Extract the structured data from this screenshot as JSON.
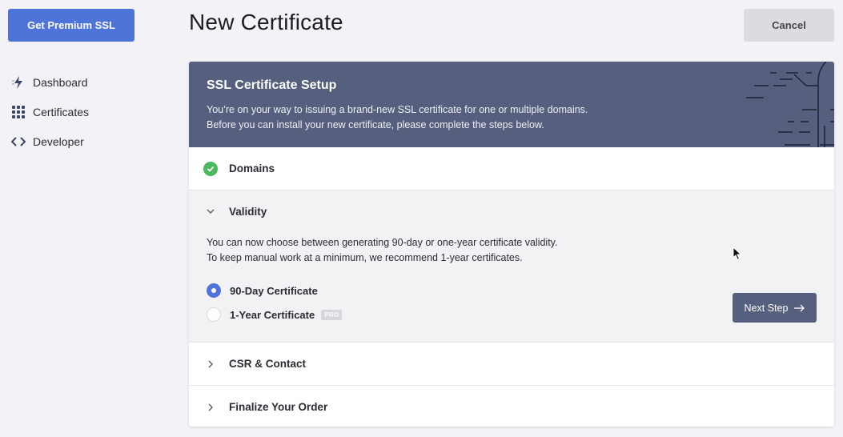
{
  "sidebar": {
    "premium_label": "Get Premium SSL",
    "items": [
      {
        "label": "Dashboard",
        "icon": "lightning-icon"
      },
      {
        "label": "Certificates",
        "icon": "grid-icon"
      },
      {
        "label": "Developer",
        "icon": "code-icon"
      }
    ]
  },
  "header": {
    "title": "New Certificate",
    "cancel_label": "Cancel"
  },
  "card": {
    "title": "SSL Certificate Setup",
    "desc_line1": "You’re on your way to issuing a brand-new SSL certificate for one or multiple domains.",
    "desc_line2": "Before you can install your new certificate, please complete the steps below."
  },
  "steps": {
    "domains": {
      "label": "Domains",
      "status": "complete"
    },
    "validity": {
      "label": "Validity",
      "desc_line1": "You can now choose between generating 90-day or one-year certificate validity.",
      "desc_line2": "To keep manual work at a minimum, we recommend 1-year certificates.",
      "options": [
        {
          "label": "90-Day Certificate",
          "selected": true
        },
        {
          "label": "1-Year Certificate",
          "selected": false,
          "badge": "PRO"
        }
      ],
      "next_label": "Next Step"
    },
    "csr": {
      "label": "CSR & Contact"
    },
    "finalize": {
      "label": "Finalize Your Order"
    }
  },
  "colors": {
    "accent": "#4f74d9",
    "header_bg": "#575f7e",
    "success": "#4bb85e"
  }
}
